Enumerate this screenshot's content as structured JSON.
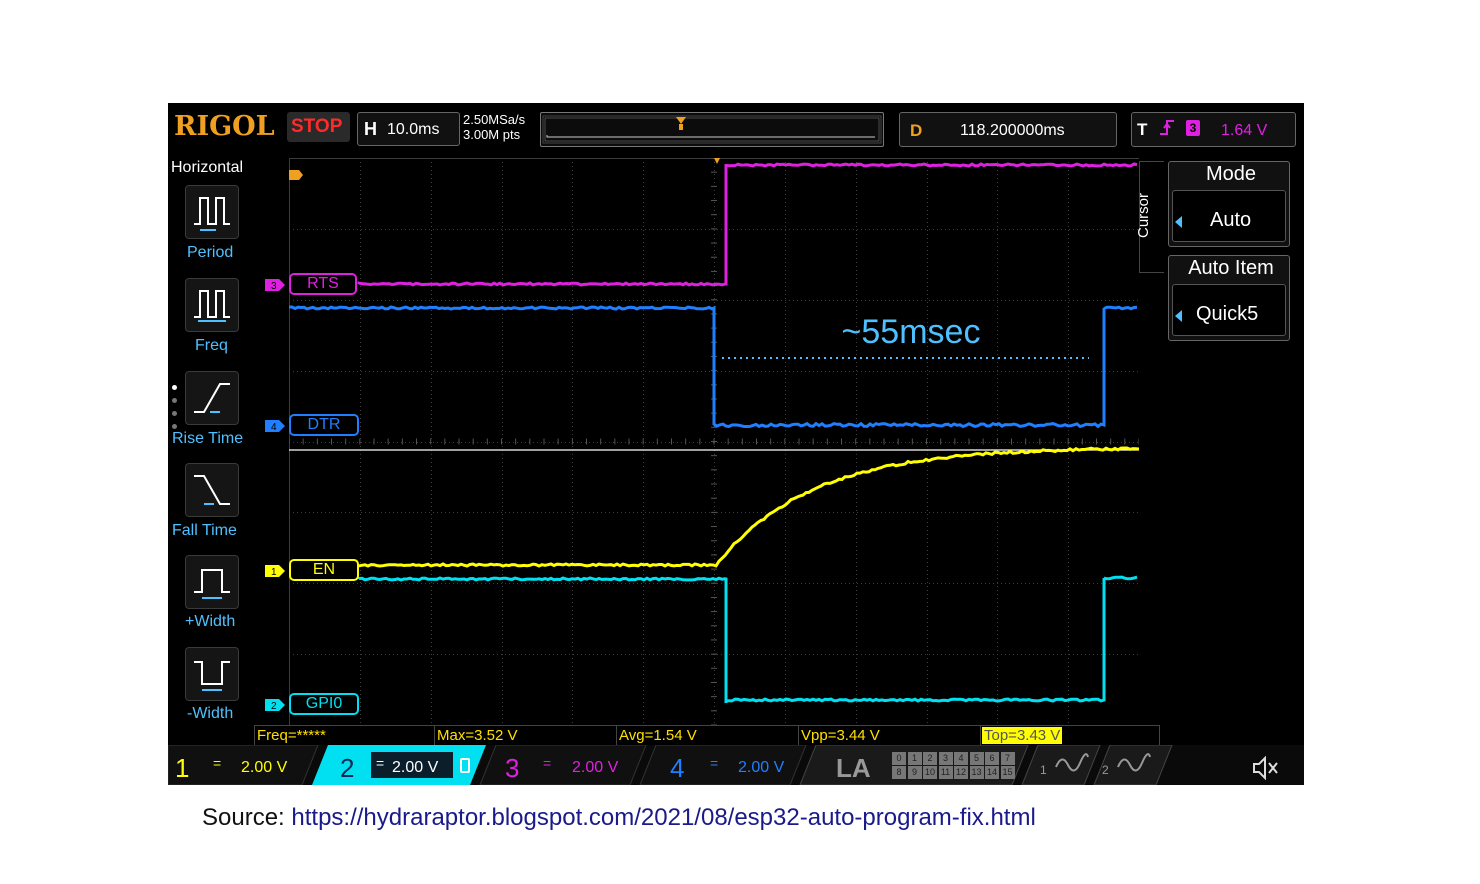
{
  "scope": {
    "brand": "RIGOL",
    "run_state": "STOP",
    "horizontal": {
      "letter": "H",
      "value": "10.0ms"
    },
    "sample_rate": "2.50MSa/s",
    "memory_depth": "3.00M pts",
    "delay": {
      "letter": "D",
      "value": "118.200000ms"
    },
    "trigger": {
      "letter": "T",
      "edge_icon": "rising-edge-icon",
      "channel": "3",
      "level": "1.64 V"
    }
  },
  "left_menu": {
    "title": "Horizontal",
    "items": [
      {
        "label": "Period",
        "icon": "period-icon"
      },
      {
        "label": "Freq",
        "icon": "freq-icon"
      },
      {
        "label": "Rise Time",
        "icon": "rise-time-icon"
      },
      {
        "label": "Fall Time",
        "icon": "fall-time-icon"
      },
      {
        "label": "+Width",
        "icon": "pos-width-icon"
      },
      {
        "label": "-Width",
        "icon": "neg-width-icon"
      }
    ]
  },
  "right_menu": {
    "side_label": "Cursor",
    "mode": {
      "title": "Mode",
      "value": "Auto"
    },
    "auto_item": {
      "title": "Auto Item",
      "value": "Quick5"
    }
  },
  "channels": {
    "rts": {
      "label": "RTS",
      "number": "3",
      "color": "#e020e0"
    },
    "dtr": {
      "label": "DTR",
      "number": "4",
      "color": "#1f7fff"
    },
    "en": {
      "label": "EN",
      "number": "1",
      "color": "#ffff00"
    },
    "gpio": {
      "label": "GPI0",
      "number": "2",
      "color": "#00e0f0"
    }
  },
  "annotation": "~55msec",
  "measurements": {
    "freq": "Freq=*****",
    "max": "Max=3.52 V",
    "avg": "Avg=1.54 V",
    "vpp": "Vpp=3.44 V",
    "top": "Top=3.43 V"
  },
  "bottom_bar": {
    "ch1": {
      "num": "1",
      "coupling": "=",
      "scale": "2.00 V"
    },
    "ch2": {
      "num": "2",
      "coupling": "=",
      "scale": "2.00 V"
    },
    "ch3": {
      "num": "3",
      "coupling": "=",
      "scale": "2.00 V"
    },
    "ch4": {
      "num": "4",
      "coupling": "=",
      "scale": "2.00 V"
    },
    "la": "LA",
    "la_grid": [
      "0",
      "1",
      "2",
      "3",
      "4",
      "5",
      "6",
      "7",
      "8",
      "9",
      "10",
      "11",
      "12",
      "13",
      "14",
      "15"
    ],
    "gen1": "1",
    "gen2": "2"
  },
  "source": {
    "prefix": "Source: ",
    "url": "https://hydraraptor.blogspot.com/2021/08/esp32-auto-program-fix.html"
  }
}
